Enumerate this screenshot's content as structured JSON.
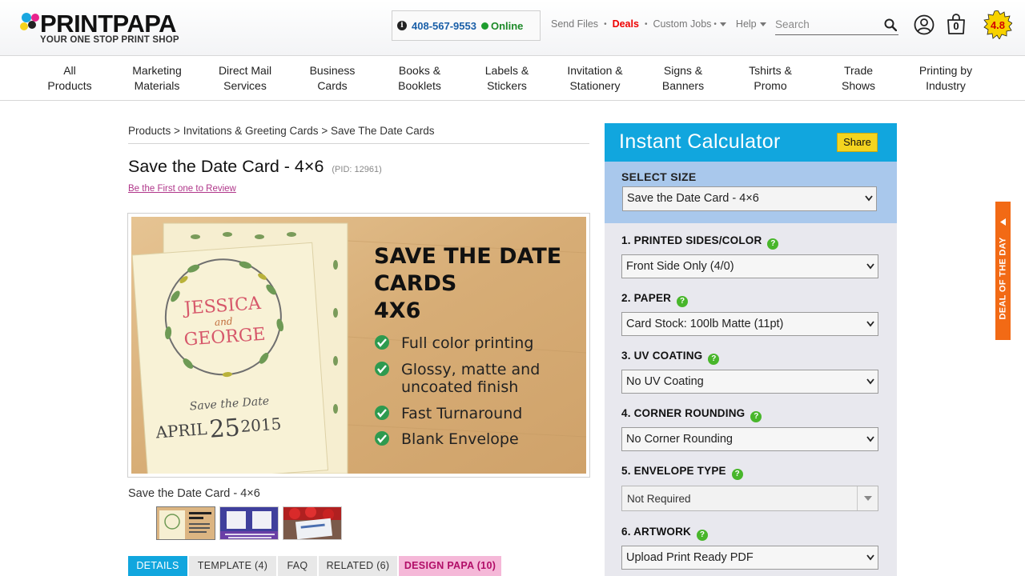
{
  "header": {
    "logo_name": "PRINTPAPA",
    "logo_tagline": "YOUR ONE STOP PRINT SHOP",
    "phone": "408-567-9553",
    "online_status": "Online",
    "links": [
      {
        "label": "Send Files"
      },
      {
        "label": "Deals"
      },
      {
        "label": "Custom Jobs"
      },
      {
        "label": "Help"
      }
    ],
    "search_placeholder": "Search",
    "cart_count": "0",
    "rating": "4.8"
  },
  "categories": [
    {
      "line1": "All",
      "line2": "Products"
    },
    {
      "line1": "Marketing",
      "line2": "Materials"
    },
    {
      "line1": "Direct Mail",
      "line2": "Services"
    },
    {
      "line1": "Business",
      "line2": "Cards"
    },
    {
      "line1": "Books &",
      "line2": "Booklets"
    },
    {
      "line1": "Labels &",
      "line2": "Stickers"
    },
    {
      "line1": "Invitation &",
      "line2": "Stationery"
    },
    {
      "line1": "Signs &",
      "line2": "Banners"
    },
    {
      "line1": "Tshirts &",
      "line2": "Promo"
    },
    {
      "line1": "Trade",
      "line2": "Shows"
    },
    {
      "line1": "Printing by",
      "line2": "Industry"
    }
  ],
  "breadcrumb": {
    "items": [
      "Products",
      "Invitations & Greeting Cards",
      "Save The Date Cards"
    ],
    "separator": ">"
  },
  "product": {
    "title": "Save the Date Card - 4×6",
    "pid": "(PID: 12961)",
    "review_link": "Be the First one to Review",
    "caption": "Save the Date Card - 4×6",
    "image": {
      "heading_lines": [
        "SAVE THE DATE",
        "CARDS",
        "4X6"
      ],
      "features": [
        "Full color printing",
        "Glossy, matte and",
        "uncoated finish",
        "Fast Turnaround",
        "Blank Envelope"
      ],
      "card_name_1": "JESSICA",
      "card_and": "and",
      "card_name_2": "GEORGE",
      "card_save": "Save the Date",
      "card_date_left": "APRIL",
      "card_date_day": "25",
      "card_date_year": "2015"
    }
  },
  "tabs": [
    {
      "label": "DETAILS"
    },
    {
      "label": "TEMPLATE (4)"
    },
    {
      "label": "FAQ"
    },
    {
      "label": "RELATED (6)"
    },
    {
      "label": "DESIGN PAPA (10)"
    }
  ],
  "calculator": {
    "title": "Instant Calculator",
    "share_label": "Share",
    "size_label": "SELECT SIZE",
    "size_value": "Save the Date Card - 4×6",
    "options": [
      {
        "label": "1. PRINTED SIDES/COLOR",
        "value": "Front Side Only (4/0)"
      },
      {
        "label": "2. PAPER",
        "value": "Card Stock: 100lb Matte (11pt)"
      },
      {
        "label": "3. UV COATING",
        "value": "No UV Coating"
      },
      {
        "label": "4. CORNER ROUNDING",
        "value": "No Corner Rounding"
      },
      {
        "label": "5. ENVELOPE TYPE",
        "value": "Not Required"
      },
      {
        "label": "6. ARTWORK",
        "value": "Upload Print Ready PDF"
      }
    ],
    "help_glyph": "?"
  },
  "deal_of_day": "DEAL OF THE DAY",
  "colors": {
    "accent_blue": "#11a6de",
    "size_box_blue": "#a9c8ec",
    "deal_orange": "#f26a15",
    "share_yellow": "#f4d41f",
    "deals_red": "#ee0000",
    "review_magenta": "#b0368a"
  }
}
